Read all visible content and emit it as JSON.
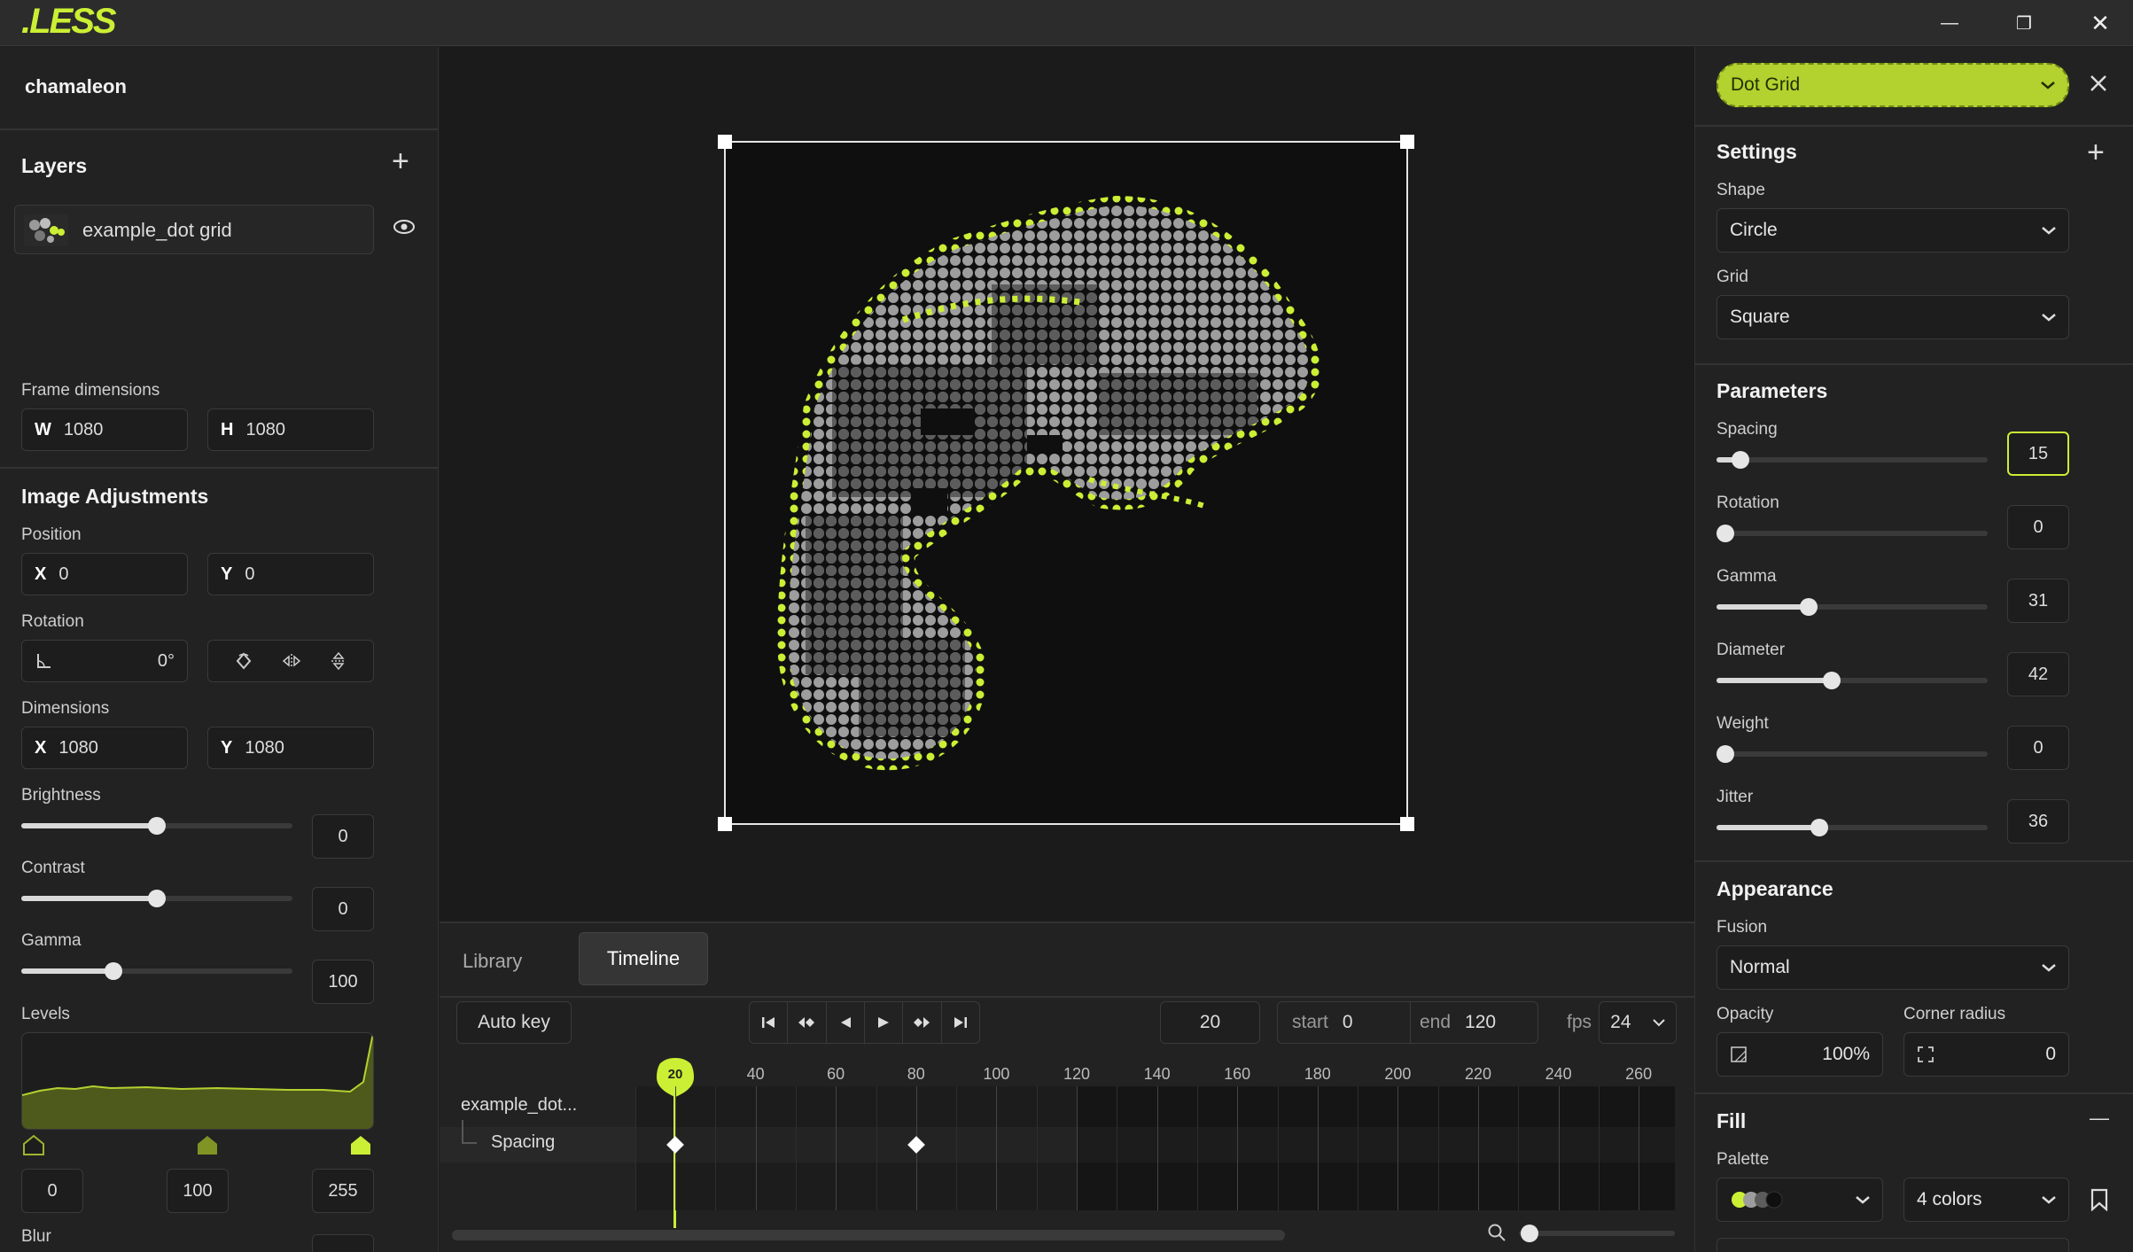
{
  "app": {
    "logo": ".LESS",
    "window": {
      "minimize": "—",
      "maximize": "❐",
      "close": "✕"
    }
  },
  "project": {
    "name": "chamaleon"
  },
  "layers": {
    "title": "Layers",
    "add": "+",
    "items": [
      {
        "name": "example_dot grid"
      }
    ]
  },
  "frame": {
    "label": "Frame dimensions",
    "w_label": "W",
    "w": "1080",
    "h_label": "H",
    "h": "1080"
  },
  "adjust": {
    "title": "Image Adjustments",
    "position": {
      "label": "Position",
      "x_label": "X",
      "x": "0",
      "y_label": "Y",
      "y": "0"
    },
    "rotation": {
      "label": "Rotation",
      "value": "0°"
    },
    "dimensions": {
      "label": "Dimensions",
      "x_label": "X",
      "x": "1080",
      "y_label": "Y",
      "y": "1080"
    },
    "brightness": {
      "label": "Brightness",
      "value": "0",
      "level": 0.5
    },
    "contrast": {
      "label": "Contrast",
      "value": "0",
      "level": 0.5
    },
    "gamma": {
      "label": "Gamma",
      "value": "100",
      "level": 0.33
    },
    "levels": {
      "label": "Levels",
      "low": "0",
      "mid": "100",
      "high": "255"
    },
    "blur": {
      "label": "Blur"
    }
  },
  "effect": {
    "name": "Dot Grid"
  },
  "settings": {
    "title": "Settings",
    "add": "+",
    "shape_label": "Shape",
    "shape": "Circle",
    "grid_label": "Grid",
    "grid": "Square"
  },
  "parameters": {
    "title": "Parameters",
    "items": [
      {
        "label": "Spacing",
        "value": "15",
        "level": 0.06,
        "active": true
      },
      {
        "label": "Rotation",
        "value": "0",
        "level": 0.0
      },
      {
        "label": "Gamma",
        "value": "31",
        "level": 0.33
      },
      {
        "label": "Diameter",
        "value": "42",
        "level": 0.42
      },
      {
        "label": "Weight",
        "value": "0",
        "level": 0.0
      },
      {
        "label": "Jitter",
        "value": "36",
        "level": 0.37
      }
    ]
  },
  "appearance": {
    "title": "Appearance",
    "fusion_label": "Fusion",
    "fusion": "Normal",
    "opacity_label": "Opacity",
    "opacity": "100%",
    "radius_label": "Corner radius",
    "radius": "0"
  },
  "fill": {
    "title": "Fill",
    "collapse": "—",
    "palette_label": "Palette",
    "colors": "4 colors"
  },
  "tabs": {
    "library": "Library",
    "timeline": "Timeline"
  },
  "timeline": {
    "autokey": "Auto key",
    "frame": "20",
    "start_label": "start",
    "start": "0",
    "end_label": "end",
    "end": "120",
    "fps_label": "fps",
    "fps": "24",
    "ticks": [
      "20",
      "40",
      "60",
      "80",
      "100",
      "120",
      "140",
      "160",
      "180",
      "200",
      "220",
      "240",
      "260"
    ],
    "track": "example_dot...",
    "sub_track": "Spacing",
    "keyframes": [
      20,
      80
    ]
  },
  "colors": {
    "accent": "#cbef35",
    "panel": "#222222",
    "canvas": "#0f0f0f"
  }
}
